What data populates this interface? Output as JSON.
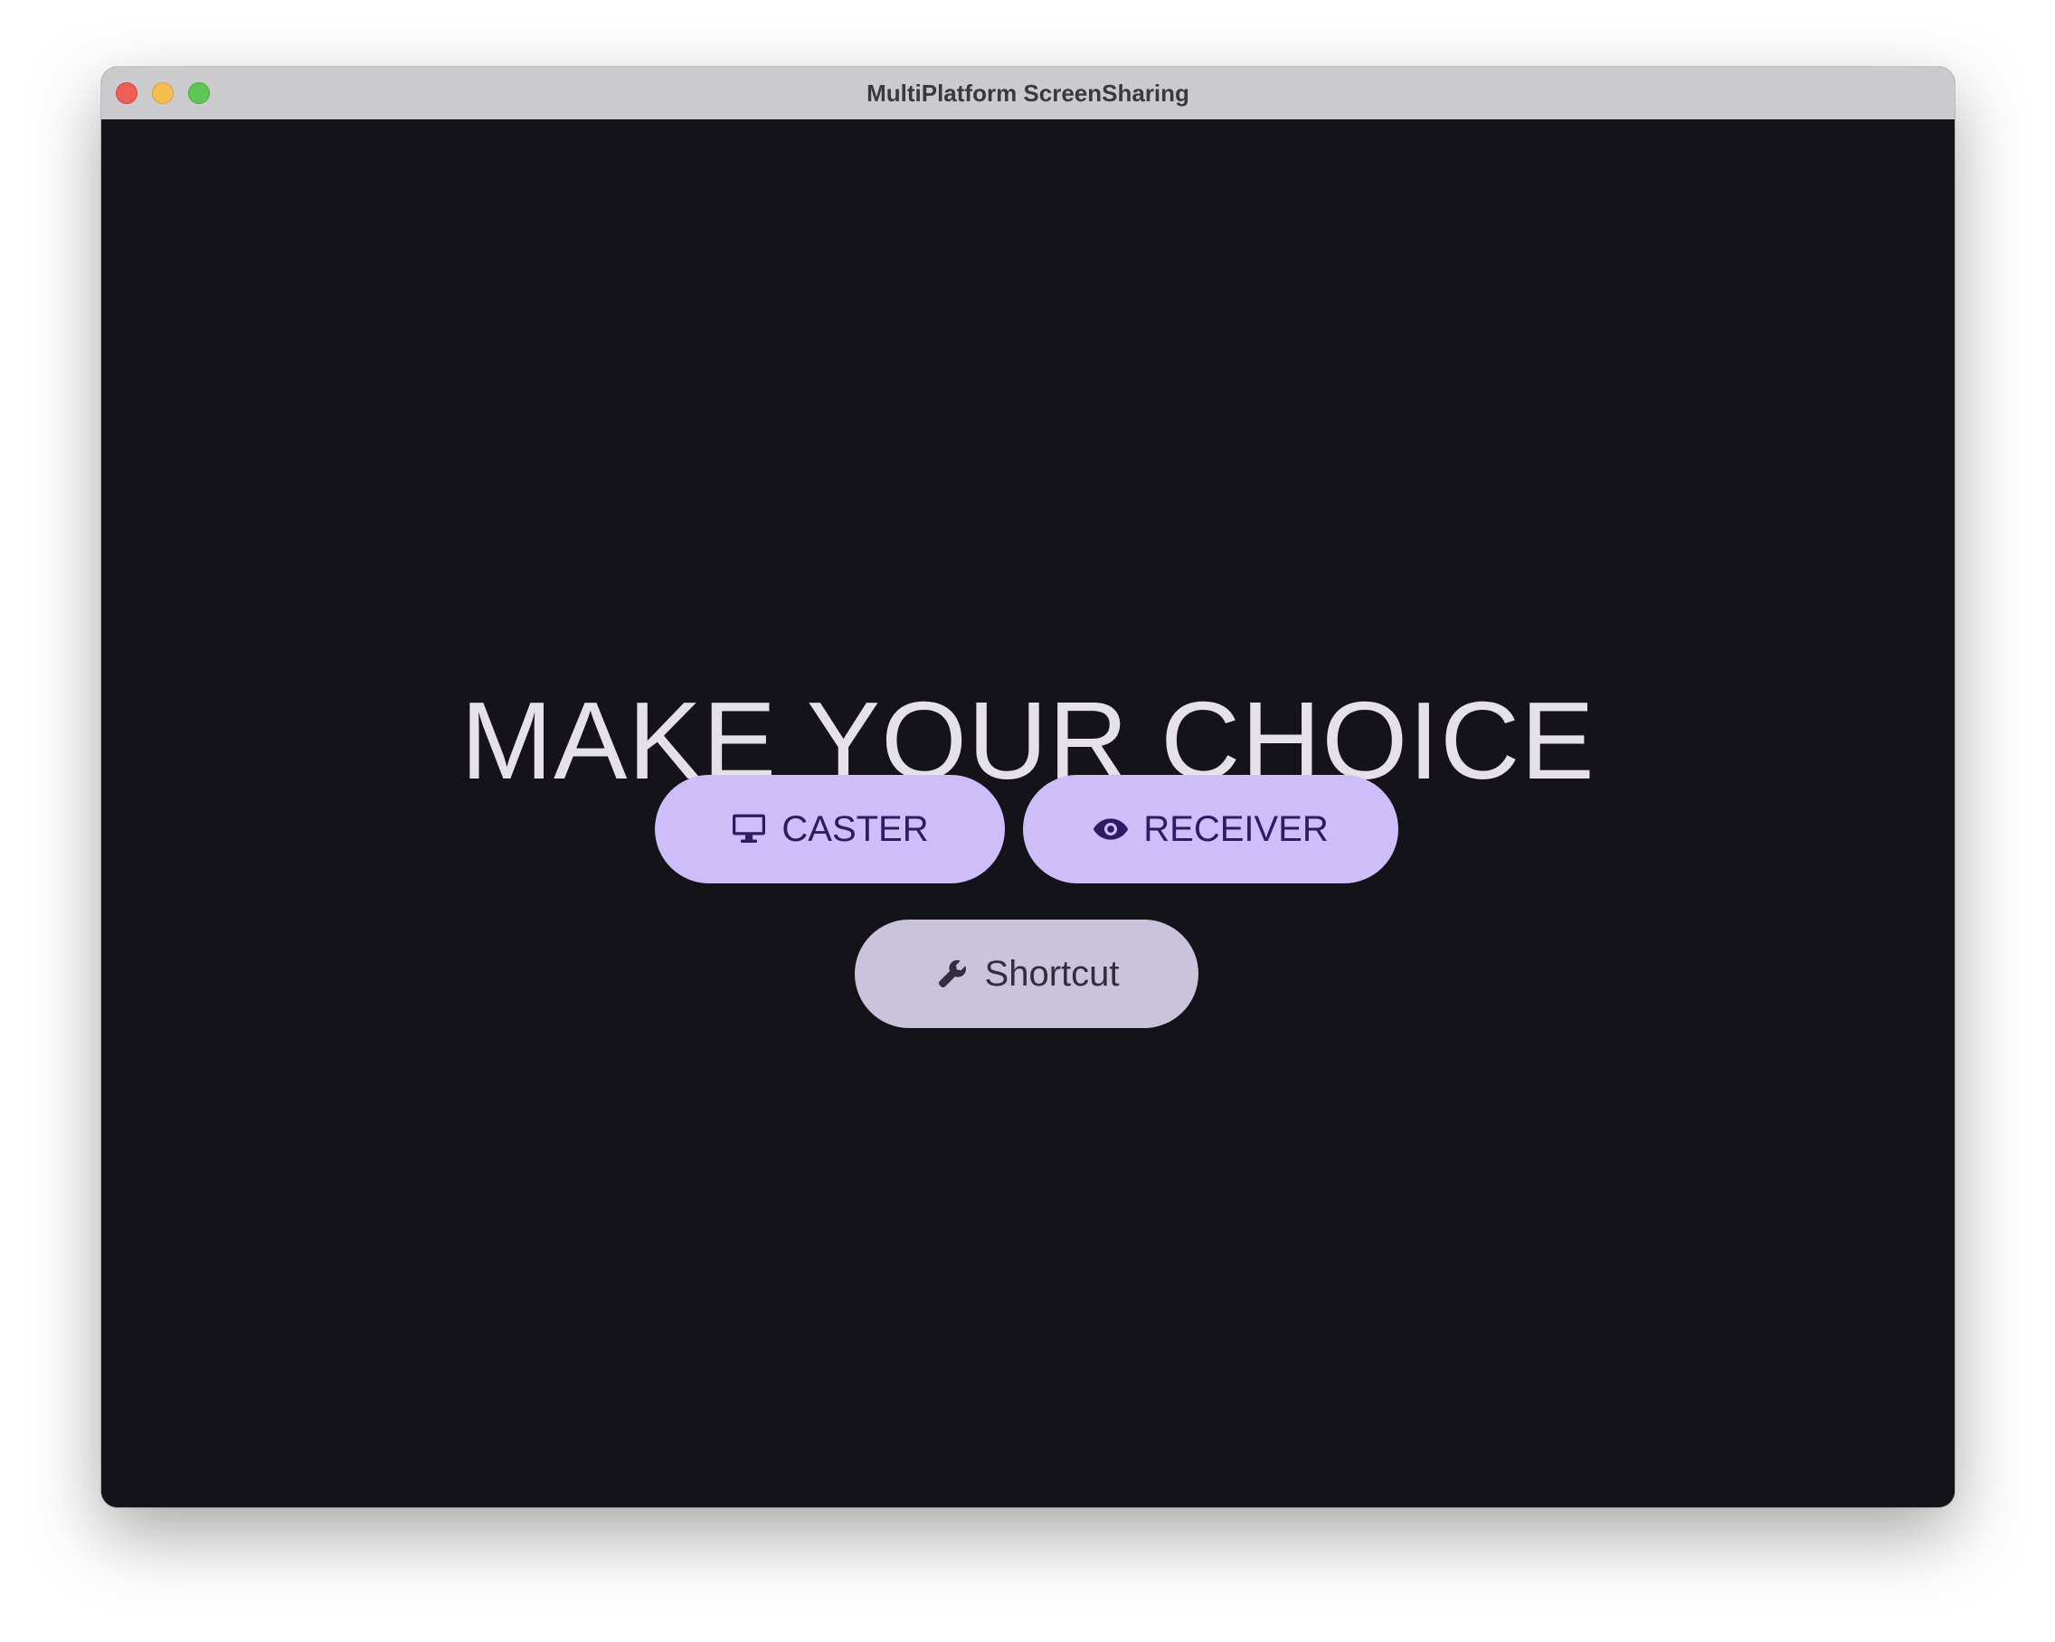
{
  "window": {
    "title": "MultiPlatform ScreenSharing",
    "controls": [
      "close",
      "minimize",
      "zoom"
    ]
  },
  "main": {
    "heading": "MAKE YOUR CHOICE",
    "buttons": {
      "caster": {
        "label": "CASTER",
        "icon": "monitor-icon"
      },
      "receiver": {
        "label": "RECEIVER",
        "icon": "eye-icon"
      },
      "shortcut": {
        "label": "Shortcut",
        "icon": "wrench-icon"
      }
    }
  },
  "colors": {
    "background": "#15131a",
    "primary_button": "#cdbdf9",
    "primary_button_text": "#2f1b63",
    "secondary_button": "#cbc2db",
    "secondary_button_text": "#332d41",
    "heading_text": "#e6e1e9"
  }
}
